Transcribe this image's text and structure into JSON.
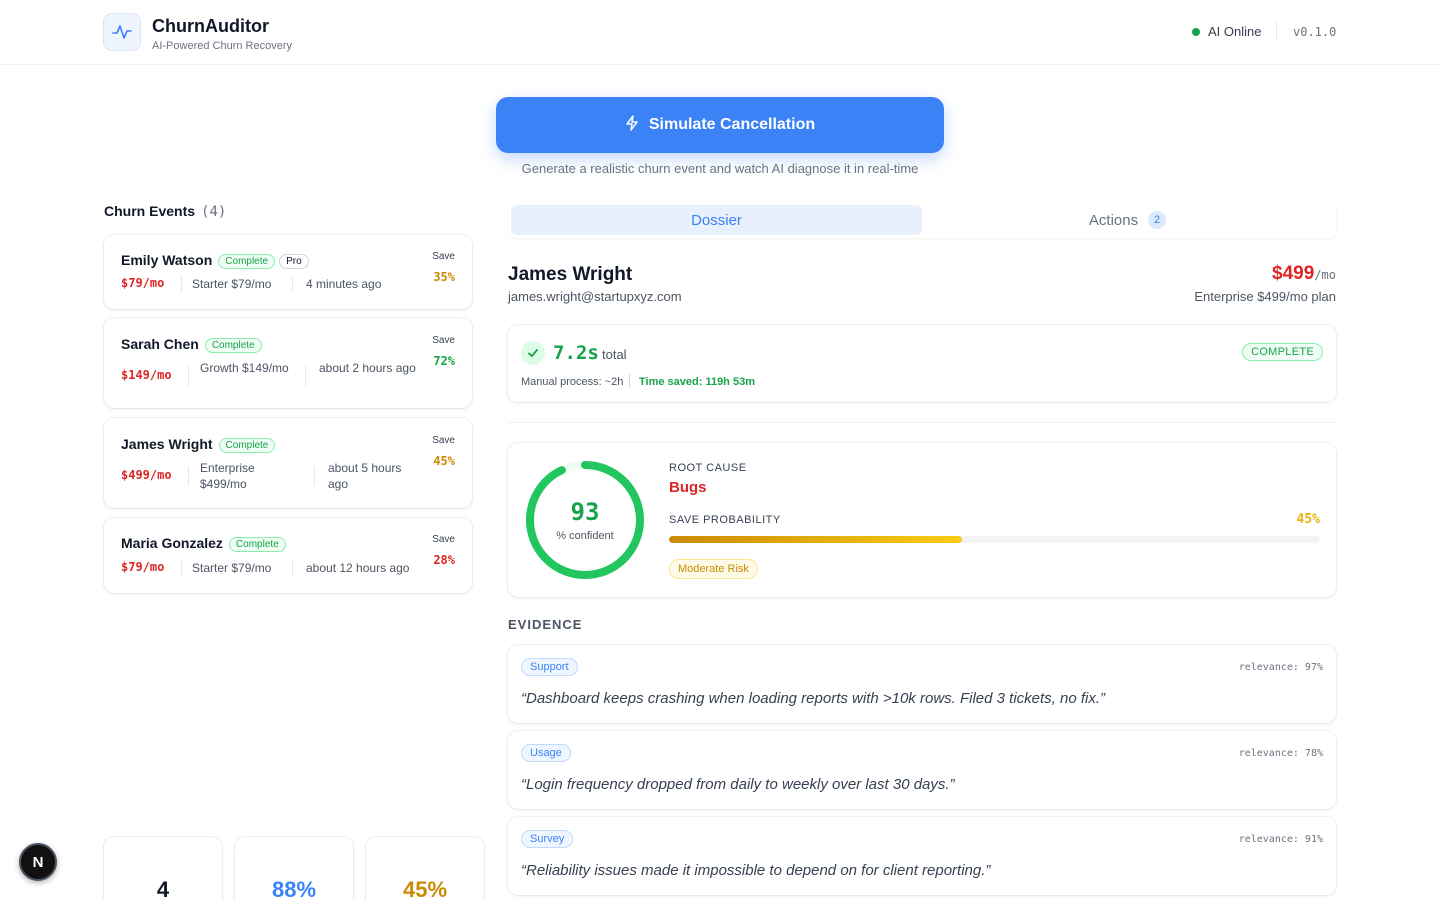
{
  "header": {
    "app_title": "ChurnAuditor",
    "app_subtitle": "AI-Powered Churn Recovery",
    "logo_icon": "activity-pulse-icon",
    "status_label": "AI Online",
    "status_color": "#16a34a",
    "version": "v0.1.0"
  },
  "simulate": {
    "button_label": "Simulate Cancellation",
    "button_icon": "lightning-bolt-icon",
    "subtitle": "Generate a realistic churn event and watch AI diagnose it in real-time",
    "accent": "#3b82f6"
  },
  "events": {
    "title": "Churn Events",
    "count": "(4)",
    "save_label": "Save",
    "items": [
      {
        "name": "Emily Watson",
        "status": "Complete",
        "tier_badge": "Pro",
        "mrr": "$79/mo",
        "plan": "Starter $79/mo",
        "time": "4 minutes ago",
        "save": "35%",
        "save_color": "#ca8a04"
      },
      {
        "name": "Sarah Chen",
        "status": "Complete",
        "tier_badge": "",
        "mrr": "$149/mo",
        "plan": "Growth $149/mo",
        "time": "about 2 hours ago",
        "save": "72%",
        "save_color": "#16a34a"
      },
      {
        "name": "James Wright",
        "status": "Complete",
        "tier_badge": "",
        "mrr": "$499/mo",
        "plan": "Enterprise $499/mo",
        "time": "about 5 hours ago",
        "save": "45%",
        "save_color": "#ca8a04"
      },
      {
        "name": "Maria Gonzalez",
        "status": "Complete",
        "tier_badge": "",
        "mrr": "$79/mo",
        "plan": "Starter $79/mo",
        "time": "about 12 hours ago",
        "save": "28%",
        "save_color": "#dc2626"
      }
    ]
  },
  "stats": [
    {
      "value": "4",
      "color": "#111827"
    },
    {
      "value": "88%",
      "color": "#3b82f6"
    },
    {
      "value": "45%",
      "color": "#ca8a04"
    }
  ],
  "nextjs_badge": "N",
  "tabs": {
    "dossier": "Dossier",
    "actions": "Actions",
    "actions_count": "2"
  },
  "dossier": {
    "name": "James Wright",
    "email": "james.wright@startupxyz.com",
    "mrr": "$499",
    "mrr_unit": "/mo",
    "plan": "Enterprise $499/mo plan",
    "timing": {
      "value": "7.2s",
      "label": "total",
      "status": "COMPLETE",
      "manual": "Manual process: ~2h",
      "time_saved": "Time saved: 119h 53m"
    },
    "diagnosis": {
      "confidence": 93,
      "confidence_label": "% confident",
      "root_cause_label": "ROOT CAUSE",
      "root_cause": "Bugs",
      "save_prob_label": "SAVE PROBABILITY",
      "save_prob": 45,
      "save_prob_text": "45%",
      "risk": "Moderate Risk"
    },
    "evidence_title": "EVIDENCE",
    "evidence": [
      {
        "source": "Support",
        "relevance": "relevance: 97%",
        "quote": "“Dashboard keeps crashing when loading reports with >10k rows. Filed 3 tickets, no fix.”"
      },
      {
        "source": "Usage",
        "relevance": "relevance: 78%",
        "quote": "“Login frequency dropped from daily to weekly over last 30 days.”"
      },
      {
        "source": "Survey",
        "relevance": "relevance: 91%",
        "quote": "“Reliability issues made it impossible to depend on for client reporting.”"
      }
    ]
  }
}
